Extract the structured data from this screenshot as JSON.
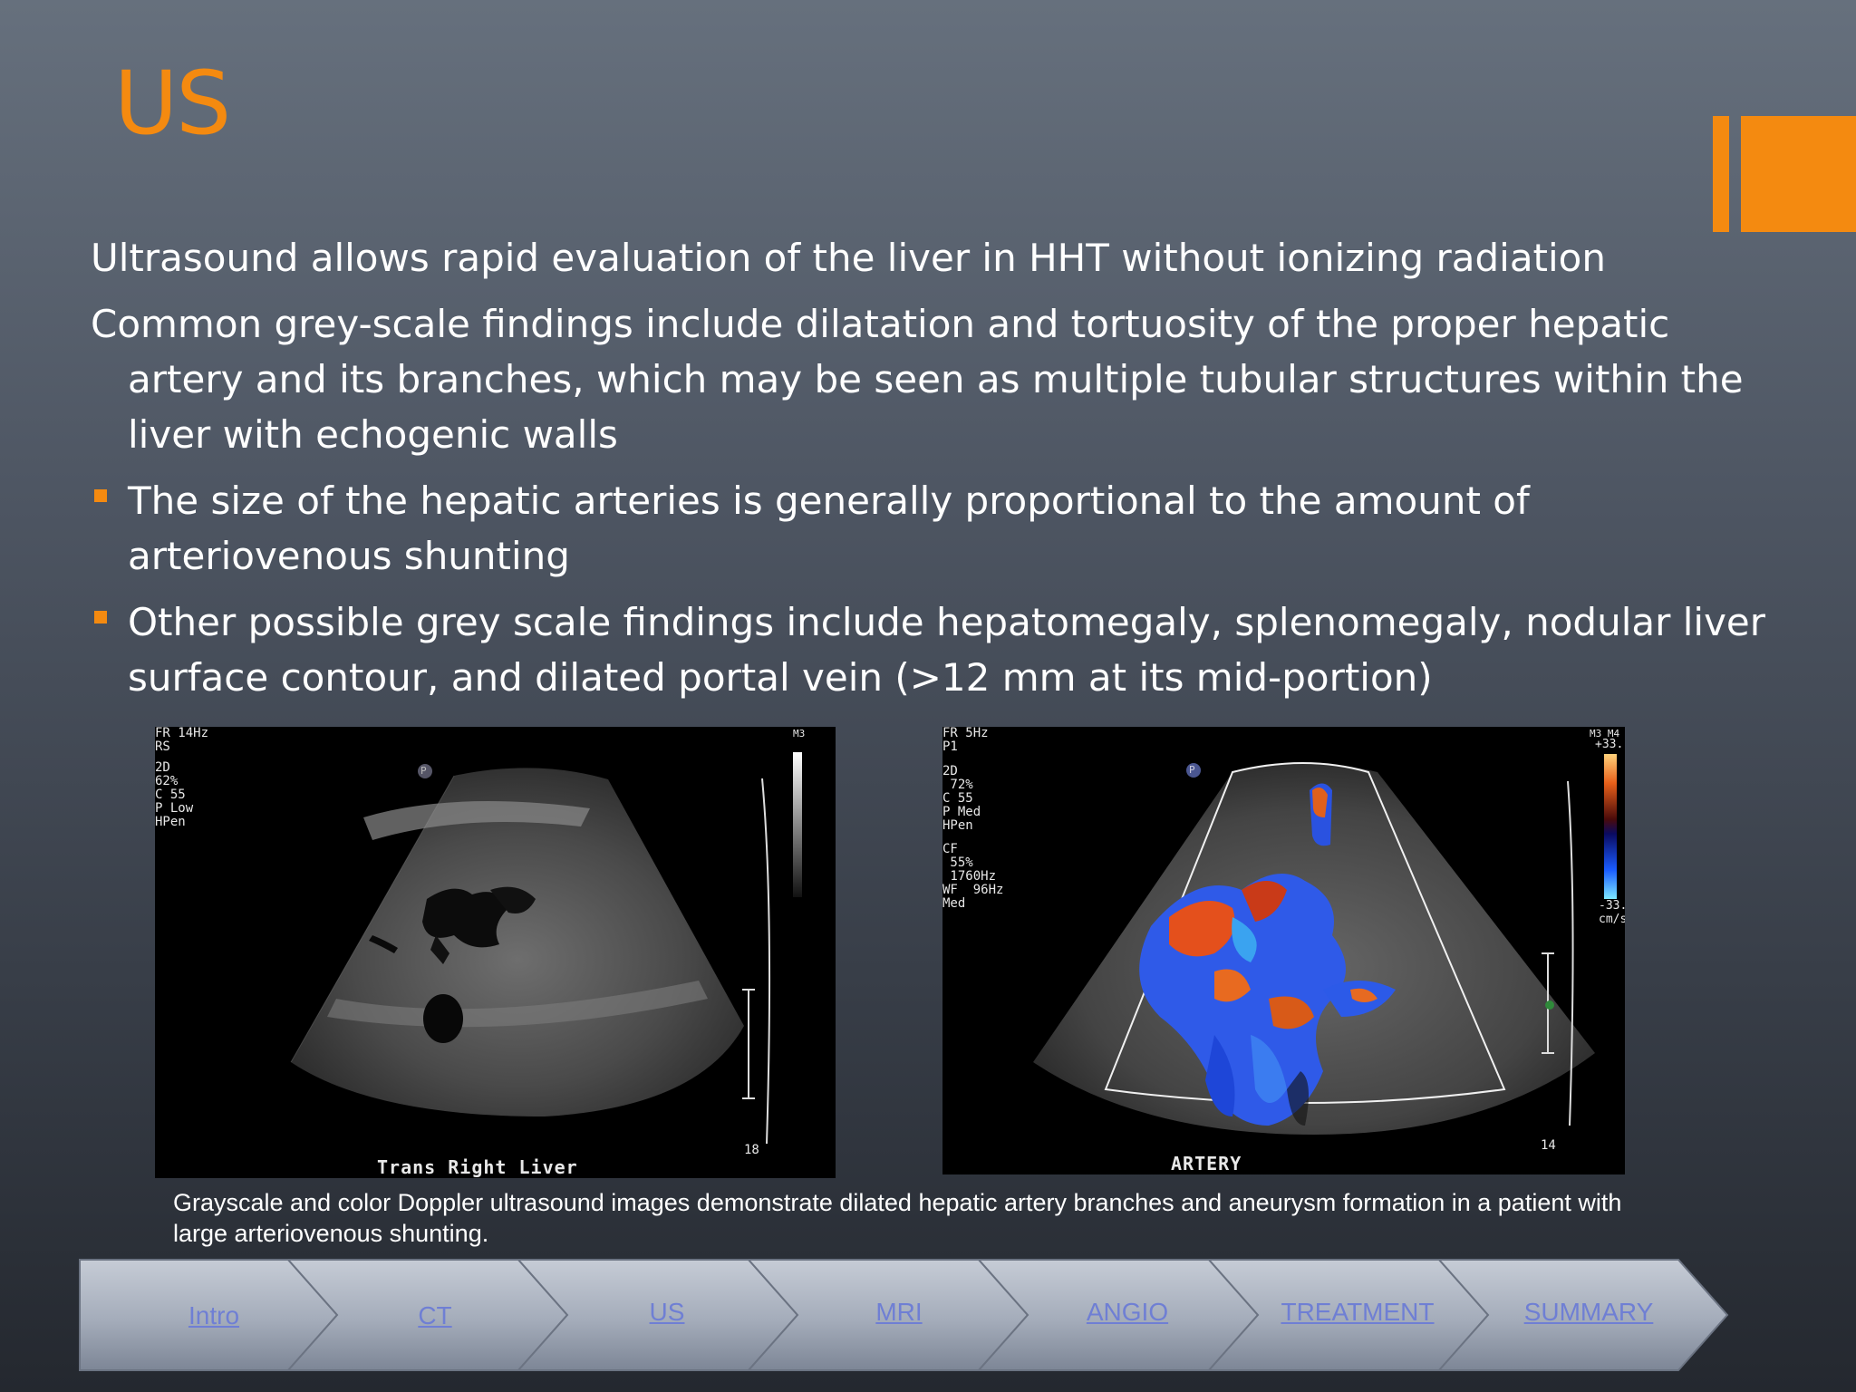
{
  "slide": {
    "title": "US",
    "paragraphs": [
      "Ultrasound allows rapid evaluation of the liver in HHT without ionizing radiation",
      "Common grey-scale findings include dilatation and tortuosity of the proper hepatic artery and its branches, which may be seen as multiple tubular structures within the liver with echogenic walls"
    ],
    "bullets": [
      "The size of the hepatic arteries is generally proportional to the amount of arteriovenous shunting",
      "Other possible grey scale findings include hepatomegaly, splenomegaly, nodular liver surface contour, and dilated portal vein (>12 mm at its mid-portion)"
    ],
    "accent_color": "#f48a10"
  },
  "images": {
    "left": {
      "top_text": "FR 14Hz\nRS",
      "params": "2D\n62%\nC 55\nP Low\nHPen",
      "map": "M3",
      "marker": "P",
      "depth": "18",
      "label": "Trans   Right   Liver"
    },
    "right": {
      "top_text": "FR 5Hz\nP1",
      "params_2d": "2D\n 72%\nC 55\nP Med\nHPen",
      "params_cf": "CF\n 55%\n 1760Hz\nWF  96Hz\nMed",
      "map": "M3 M4",
      "scale_top": "+33.",
      "scale_bottom": "-33.\ncm/s",
      "marker": "P",
      "depth": "14",
      "label": "ARTERY"
    }
  },
  "caption": "Grayscale and color Doppler ultrasound images demonstrate dilated hepatic artery branches and aneurysm formation in a patient with large arteriovenous shunting.",
  "nav": {
    "items": [
      {
        "label": "Intro"
      },
      {
        "label": "CT"
      },
      {
        "label": "US"
      },
      {
        "label": "MRI"
      },
      {
        "label": "ANGIO"
      },
      {
        "label": "TREATMENT"
      },
      {
        "label": "SUMMARY"
      }
    ]
  }
}
